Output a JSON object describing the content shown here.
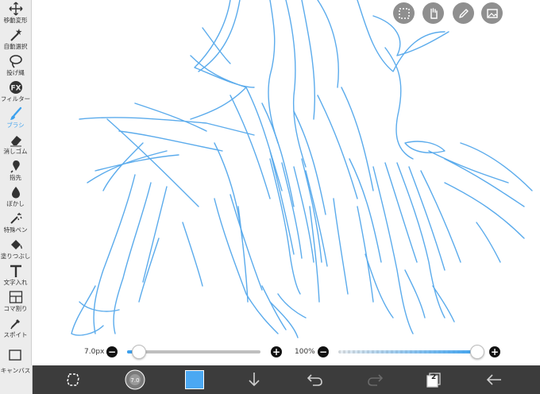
{
  "tools": [
    {
      "id": "move",
      "label": "移動変形",
      "icon": "move-arrows-icon"
    },
    {
      "id": "magic",
      "label": "自動選択",
      "icon": "magic-wand-icon"
    },
    {
      "id": "lasso",
      "label": "投げ縄",
      "icon": "lasso-icon"
    },
    {
      "id": "fx",
      "label": "フィルター",
      "icon": "fx-icon"
    },
    {
      "id": "brush",
      "label": "ブラシ",
      "icon": "brush-icon",
      "active": true
    },
    {
      "id": "eraser",
      "label": "消しゴム",
      "icon": "eraser-icon"
    },
    {
      "id": "finger",
      "label": "指先",
      "icon": "finger-icon"
    },
    {
      "id": "blur",
      "label": "ぼかし",
      "icon": "blur-drop-icon"
    },
    {
      "id": "special",
      "label": "特殊ペン",
      "icon": "special-pen-icon"
    },
    {
      "id": "fill",
      "label": "塗りつぶし",
      "icon": "bucket-icon"
    },
    {
      "id": "text",
      "label": "文字入れ",
      "icon": "text-t-icon"
    },
    {
      "id": "frame",
      "label": "コマ割り",
      "icon": "frame-divider-icon"
    },
    {
      "id": "eyedropper",
      "label": "スポイト",
      "icon": "eyedropper-icon"
    }
  ],
  "canvas_tool_label": "キャンバス",
  "brush_size": {
    "value": "7.0px",
    "fraction": 0.05
  },
  "opacity": {
    "value": "100%",
    "fraction": 1.0
  },
  "layer_count": "2",
  "colors": {
    "accent": "#3da1ee",
    "current_color": "#4ba8f2",
    "sketch": "#4aa3ea",
    "bottom_bar": "#3c3c3c"
  },
  "top_buttons": [
    "selection-icon",
    "hand-icon",
    "pen-icon",
    "image-icon"
  ],
  "bottom_buttons": [
    "transform-icon",
    "brush-preview",
    "color-swatch",
    "download-icon",
    "undo-icon",
    "redo-icon",
    "layers-icon",
    "back-arrow-icon"
  ]
}
